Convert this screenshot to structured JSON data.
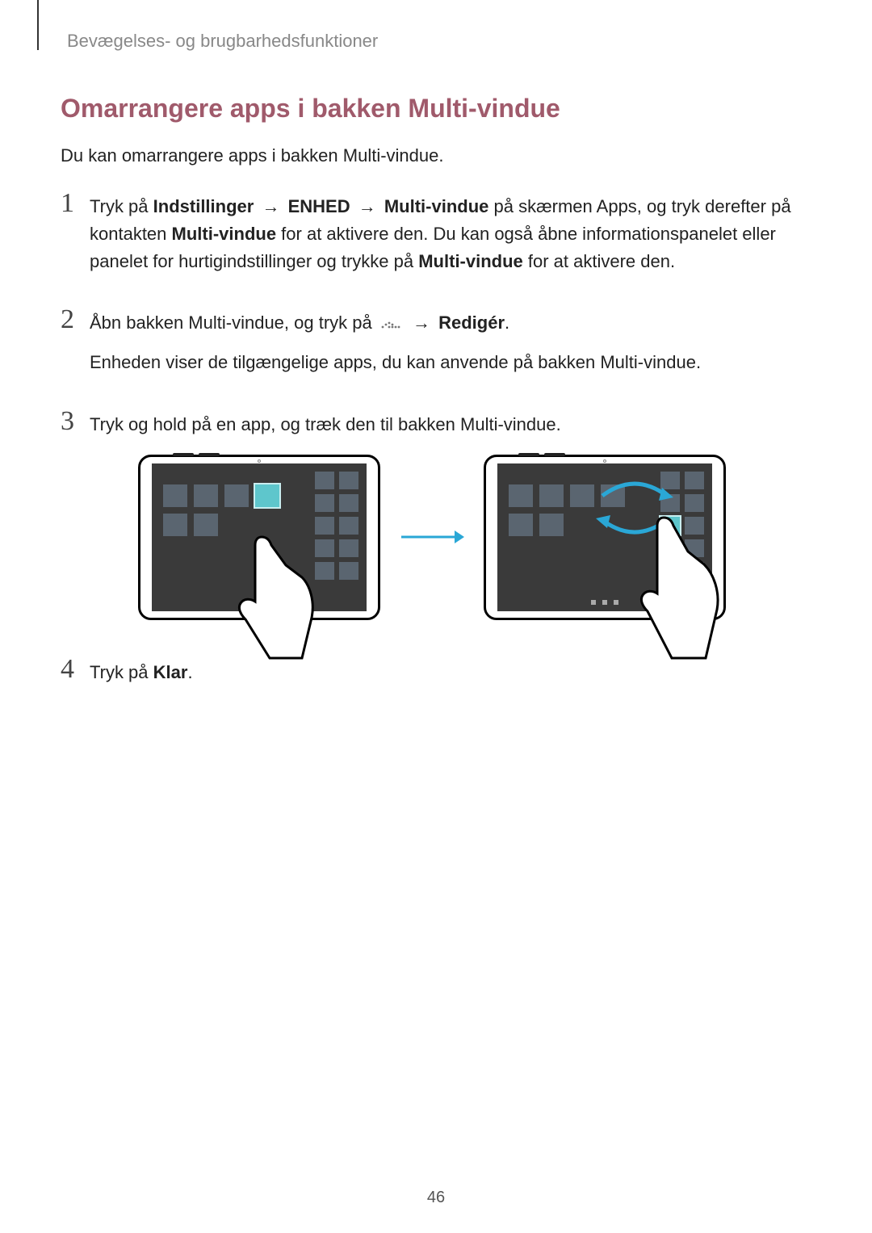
{
  "header": {
    "breadcrumb": "Bevægelses- og brugbarhedsfunktioner"
  },
  "section": {
    "heading": "Omarrangere apps i bakken Multi-vindue",
    "intro": "Du kan omarrangere apps i bakken Multi-vindue."
  },
  "steps": {
    "s1": {
      "num": "1",
      "pre": "Tryk på ",
      "b1": "Indstillinger",
      "arr1": " → ",
      "b2": "ENHED",
      "arr2": " → ",
      "b3": "Multi-vindue",
      "mid1": " på skærmen Apps, og tryk derefter på kontakten ",
      "b4": "Multi-vindue",
      "mid2": " for at aktivere den. Du kan også åbne informationspanelet eller panelet for hurtigindstillinger og trykke på ",
      "b5": "Multi-vindue",
      "post": " for at aktivere den."
    },
    "s2": {
      "num": "2",
      "line1a": "Åbn bakken Multi-vindue, og tryk på ",
      "line1arr": " → ",
      "line1b": "Redigér",
      "line1post": ".",
      "line2": "Enheden viser de tilgængelige apps, du kan anvende på bakken Multi-vindue."
    },
    "s3": {
      "num": "3",
      "text": "Tryk og hold på en app, og træk den til bakken Multi-vindue."
    },
    "s4": {
      "num": "4",
      "pre": "Tryk på ",
      "b1": "Klar",
      "post": "."
    }
  },
  "pageNumber": "46"
}
